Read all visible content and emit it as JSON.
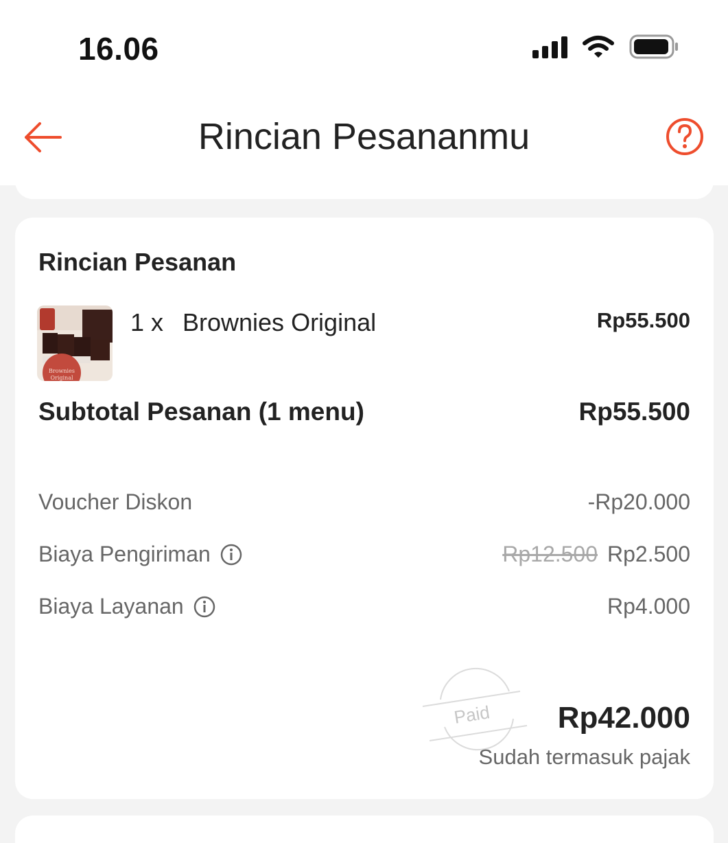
{
  "status_bar": {
    "time": "16.06"
  },
  "header": {
    "title": "Rincian Pesananmu",
    "back_icon": "arrow-left-icon",
    "help_icon": "question-circle-icon",
    "accent_color": "#ee4d2d"
  },
  "order": {
    "section_title": "Rincian Pesanan",
    "items": [
      {
        "qty": "1 x",
        "name": "Brownies Original",
        "price": "Rp55.500"
      }
    ],
    "subtotal_label": "Subtotal Pesanan (1 menu)",
    "subtotal_value": "Rp55.500",
    "voucher_label": "Voucher Diskon",
    "voucher_value": "-Rp20.000",
    "shipping_label": "Biaya Pengiriman",
    "shipping_original": "Rp12.500",
    "shipping_value": "Rp2.500",
    "service_label": "Biaya Layanan",
    "service_value": "Rp4.000",
    "total_value": "Rp42.000",
    "total_note": "Sudah termasuk pajak",
    "stamp_text": "Paid"
  }
}
